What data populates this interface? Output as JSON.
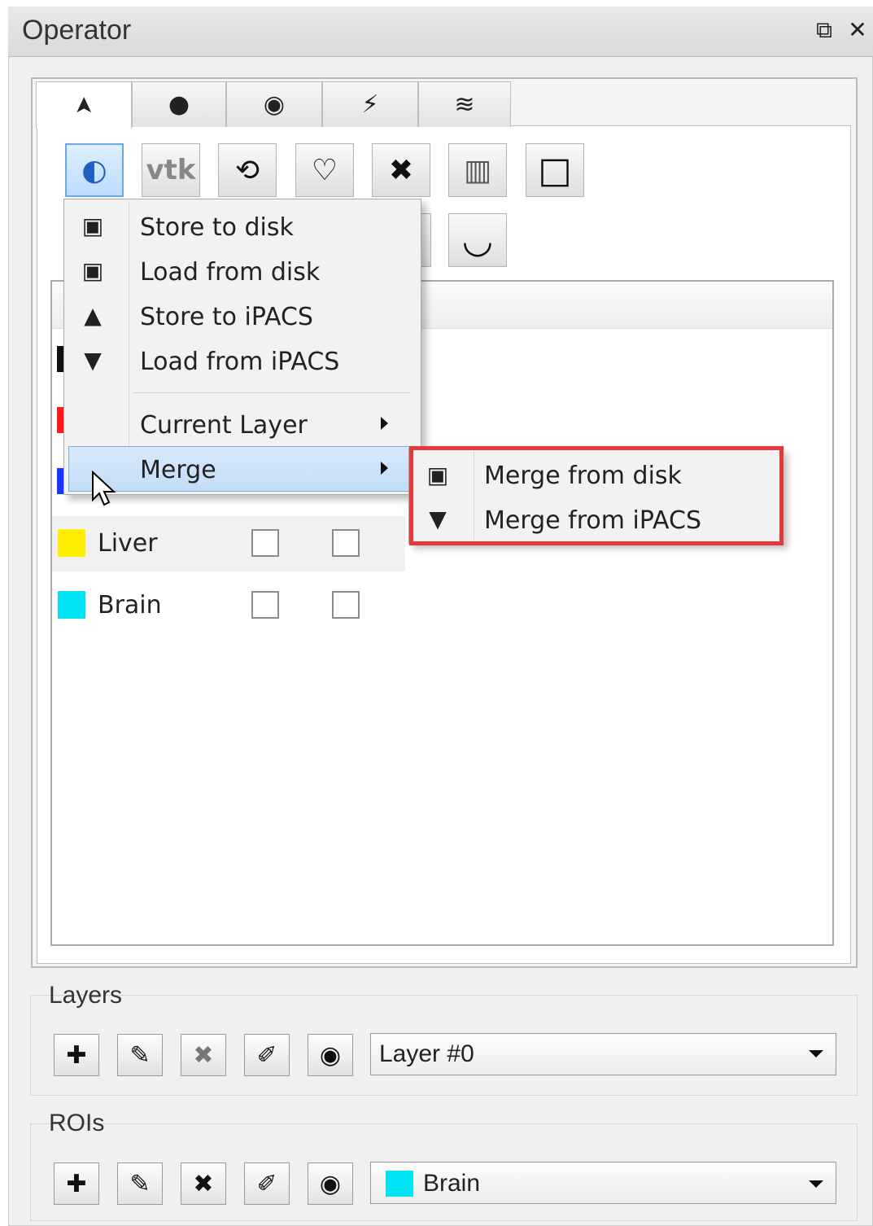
{
  "window": {
    "title": "Operator",
    "float_icon": "⧉",
    "close_icon": "✕"
  },
  "tabs": [
    {
      "icon": "pointer-icon",
      "glyph": "➤"
    },
    {
      "icon": "dot-icon",
      "glyph": "●"
    },
    {
      "icon": "eye-icon",
      "glyph": "◉"
    },
    {
      "icon": "wand-icon",
      "glyph": "⚡"
    },
    {
      "icon": "layers-icon",
      "glyph": "≋"
    }
  ],
  "toolbar": {
    "segment_glyph": "◐",
    "vtk_label": "vtk",
    "camera_glyph": "⟲",
    "lasso_glyph": "♡",
    "delete_glyph": "✖",
    "histogram_glyph": "▥",
    "rect_glyph": "□",
    "curve_glyph": "◡"
  },
  "rois": [
    {
      "label": "Liver",
      "color": "#ffee00"
    },
    {
      "label": "Brain",
      "color": "#00e5f5"
    }
  ],
  "partial_swatches": [
    "#111111",
    "#ff1a1a",
    "#1a33ff"
  ],
  "menu": {
    "store_disk": "Store to disk",
    "load_disk": "Load from disk",
    "store_ipacs": "Store to iPACS",
    "load_ipacs": "Load from iPACS",
    "current_layer": "Current Layer",
    "merge": "Merge"
  },
  "submenu": {
    "merge_disk": "Merge from disk",
    "merge_ipacs": "Merge from iPACS"
  },
  "layers": {
    "title": "Layers",
    "selected": "Layer #0"
  },
  "rois_section": {
    "title": "ROIs",
    "selected": "Brain",
    "selected_color": "#00e5f5"
  },
  "highlight_color": "#e5383b"
}
